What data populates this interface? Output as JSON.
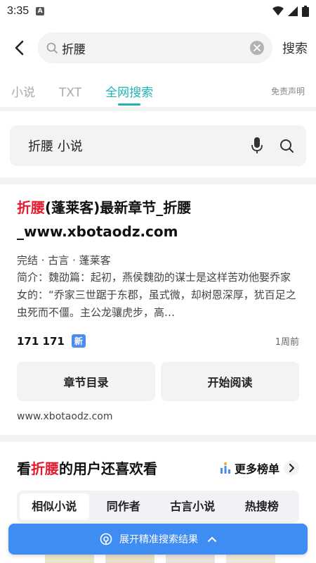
{
  "status": {
    "time": "3:35"
  },
  "search": {
    "query": "折腰",
    "button_label": "搜索"
  },
  "tabs": [
    {
      "label": "小说",
      "active": false
    },
    {
      "label": "TXT",
      "active": false
    },
    {
      "label": "全网搜索",
      "active": true
    }
  ],
  "disclaimer": "免责声明",
  "query_box": {
    "text": "折腰 小说"
  },
  "result": {
    "title_highlight": "折腰",
    "title_rest": "(蓬莱客)最新章节_折腰_www.xbotaodz.com",
    "meta": "完结 · 古言 · 蓬莱客",
    "description": "简介：魏劭篇：起初，燕侯魏劭的谋士是这样苦劝他娶乔家女的：“乔家三世踞于东郡，虽式微，却树恩深厚，犹百足之虫死而不僵。主公龙骧虎步，高…",
    "count": "171 171",
    "badge": "新",
    "time_ago": "1周前",
    "btn_toc": "章节目录",
    "btn_read": "开始阅读",
    "url": "www.xbotaodz.com"
  },
  "recommend": {
    "title_prefix": "看",
    "title_highlight": "折腰",
    "title_suffix": "的用户还喜欢看",
    "more_label": "更多榜单",
    "tabs": [
      "相似小说",
      "同作者",
      "古言小说",
      "热搜榜"
    ]
  },
  "expand_label": "展开精准搜索结果",
  "colors": {
    "accent": "#22b3b3",
    "highlight": "#e8192c",
    "primary_blue": "#3f8cf2"
  }
}
